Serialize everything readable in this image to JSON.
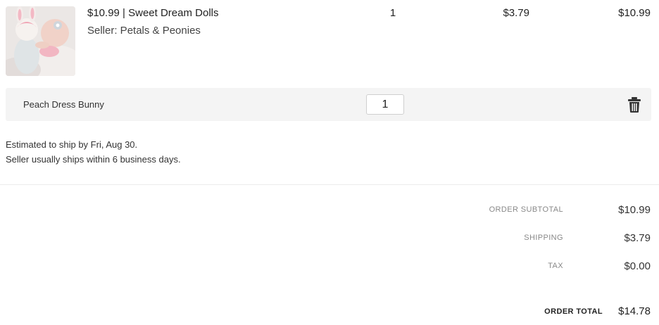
{
  "item": {
    "title": "$10.99 | Sweet Dream Dolls",
    "seller": "Seller: Petals & Peonies",
    "quantity": "1",
    "shipping": "$3.79",
    "total": "$10.99",
    "image_icon": "product-photo-doll-with-baby"
  },
  "variant": {
    "name": "Peach Dress Bunny",
    "quantity_value": "1",
    "delete_icon": "trash-icon"
  },
  "shipping_info": {
    "estimate": "Estimated to ship by Fri, Aug 30.",
    "note": "Seller usually ships within 6 business days."
  },
  "summary": {
    "subtotal_label": "ORDER SUBTOTAL",
    "subtotal_value": "$10.99",
    "shipping_label": "SHIPPING",
    "shipping_value": "$3.79",
    "tax_label": "TAX",
    "tax_value": "$0.00",
    "total_label": "ORDER TOTAL",
    "total_value": "$14.78"
  },
  "colors": {
    "variant_row_bg": "#f4f4f4",
    "label_gray": "#888888",
    "text_dark": "#222222"
  }
}
